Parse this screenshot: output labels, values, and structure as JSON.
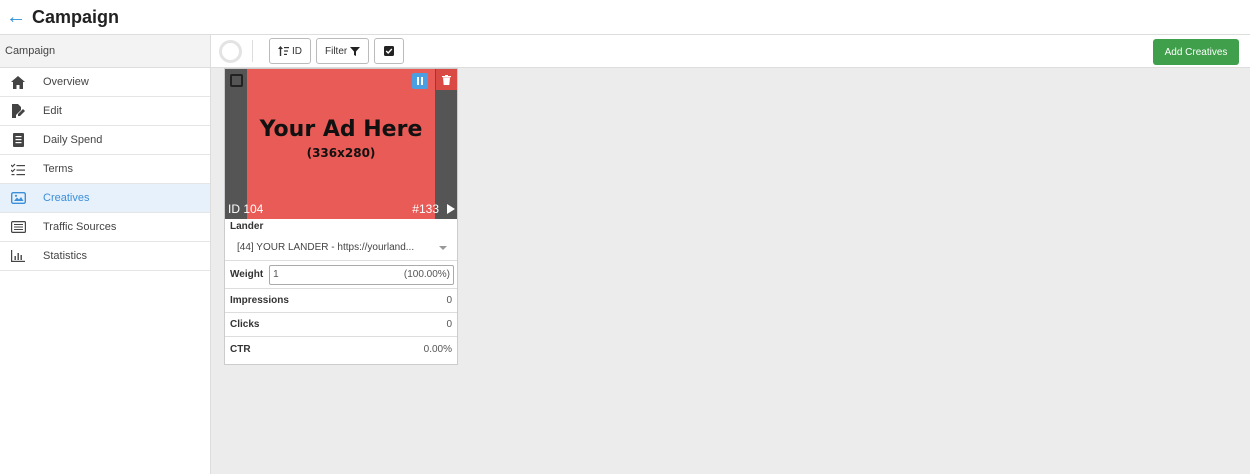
{
  "header": {
    "title": "Campaign"
  },
  "sidebar": {
    "header": "Campaign",
    "items": [
      {
        "label": "Overview",
        "icon": "home-icon"
      },
      {
        "label": "Edit",
        "icon": "edit-icon"
      },
      {
        "label": "Daily Spend",
        "icon": "document-icon"
      },
      {
        "label": "Terms",
        "icon": "checklist-icon"
      },
      {
        "label": "Creatives",
        "icon": "image-icon",
        "active": true
      },
      {
        "label": "Traffic Sources",
        "icon": "list-icon"
      },
      {
        "label": "Statistics",
        "icon": "bar-chart-icon"
      }
    ]
  },
  "toolbar": {
    "sort_label": "ID",
    "filter_label": "Filter",
    "add_label": "Add Creatives",
    "add_color": "#3f9f4a"
  },
  "creative": {
    "ad_line1": "Your Ad Here",
    "ad_line2": "(336x280)",
    "id_label": "ID 104",
    "num_label": "#133",
    "lander_header": "Lander",
    "lander_value": "[44] YOUR LANDER - https://yourland...",
    "weight_label": "Weight",
    "weight_value": "1",
    "weight_pct": "(100.00%)",
    "impressions_label": "Impressions",
    "impressions_value": "0",
    "clicks_label": "Clicks",
    "clicks_value": "0",
    "ctr_label": "CTR",
    "ctr_value": "0.00%"
  }
}
